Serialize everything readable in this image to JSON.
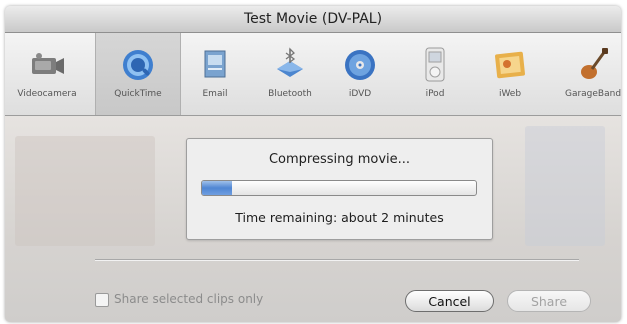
{
  "window": {
    "title": "Test Movie (DV-PAL)"
  },
  "toolbar": {
    "selected": "QuickTime",
    "items": [
      {
        "label": "Videocamera",
        "icon": "videocamera-icon"
      },
      {
        "label": "QuickTime",
        "icon": "quicktime-icon"
      },
      {
        "label": "Email",
        "icon": "email-icon"
      },
      {
        "label": "Bluetooth",
        "icon": "bluetooth-icon"
      },
      {
        "label": "iDVD",
        "icon": "idvd-icon"
      },
      {
        "label": "iPod",
        "icon": "ipod-icon"
      },
      {
        "label": "iWeb",
        "icon": "iweb-icon"
      },
      {
        "label": "GarageBand",
        "icon": "garageband-icon"
      }
    ]
  },
  "progress": {
    "status": "Compressing movie...",
    "time_remaining": "Time remaining: about 2 minutes",
    "fraction": 0.11,
    "bar_color": "#4f86d3"
  },
  "options": {
    "share_selected_label": "Share selected clips only",
    "share_selected_checked": false
  },
  "buttons": {
    "cancel_label": "Cancel",
    "share_label": "Share"
  }
}
